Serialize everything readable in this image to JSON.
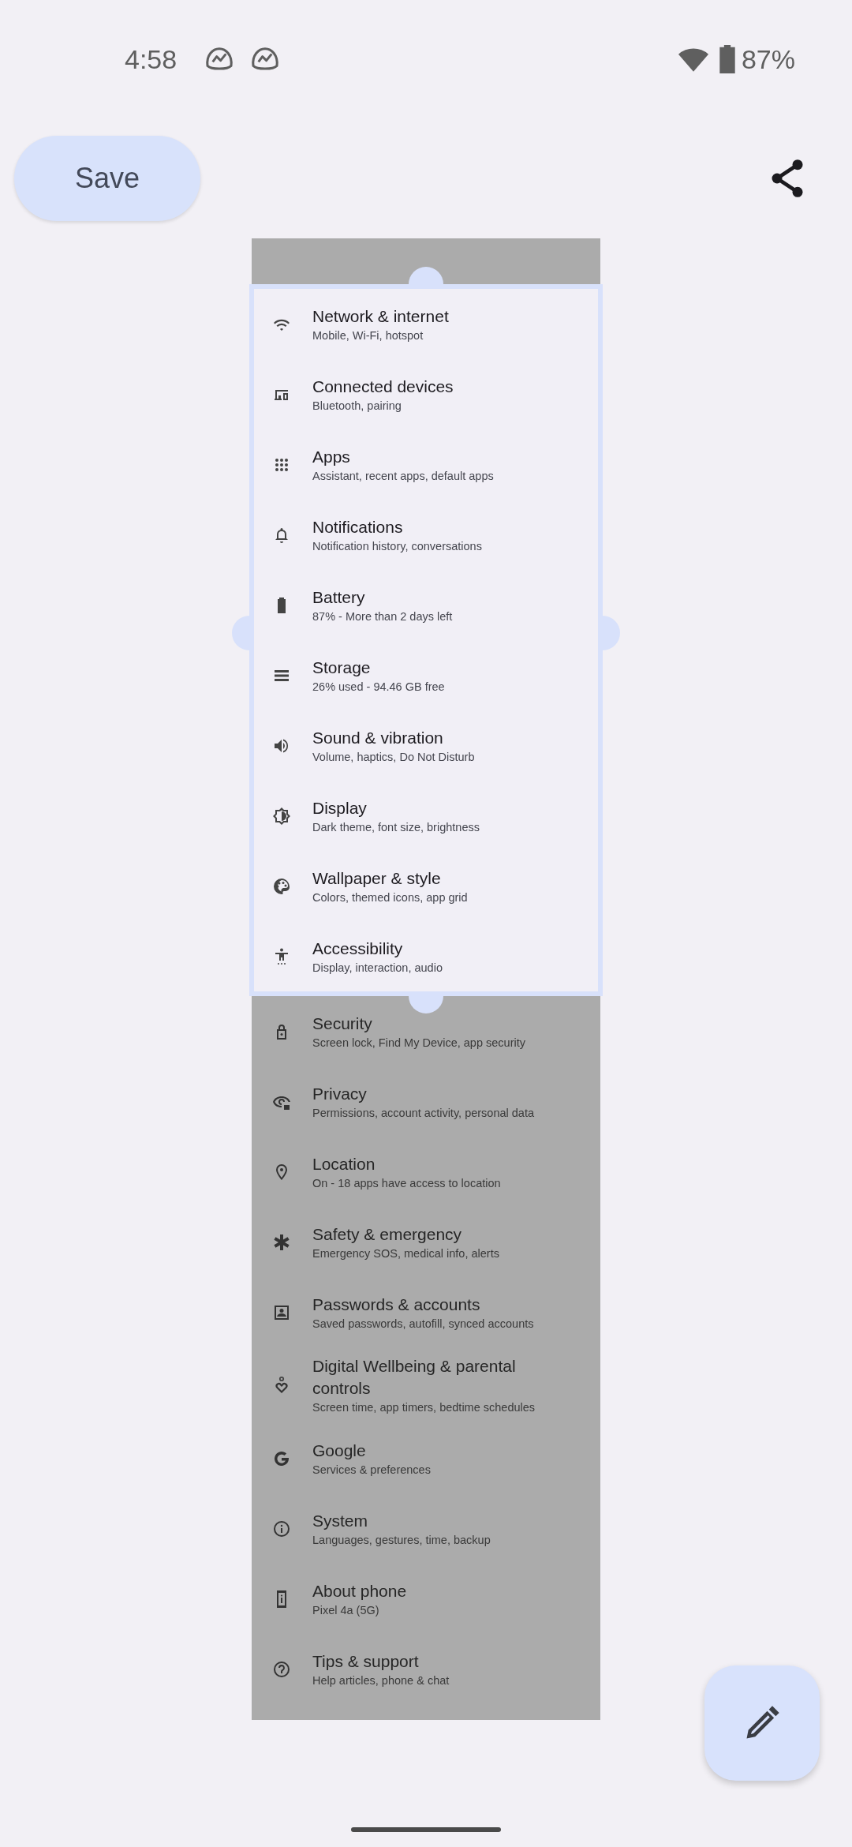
{
  "status_bar": {
    "time": "4:58",
    "battery": "87%"
  },
  "toolbar": {
    "save_button": "Save"
  },
  "screenshot": {
    "inside_crop": [
      {
        "title": "Network & internet",
        "subtitle": "Mobile, Wi-Fi, hotspot"
      },
      {
        "title": "Connected devices",
        "subtitle": "Bluetooth, pairing"
      },
      {
        "title": "Apps",
        "subtitle": "Assistant, recent apps, default apps"
      },
      {
        "title": "Notifications",
        "subtitle": "Notification history, conversations"
      },
      {
        "title": "Battery",
        "subtitle": "87% - More than 2 days left"
      },
      {
        "title": "Storage",
        "subtitle": "26% used - 94.46 GB free"
      },
      {
        "title": "Sound & vibration",
        "subtitle": "Volume, haptics, Do Not Disturb"
      },
      {
        "title": "Display",
        "subtitle": "Dark theme, font size, brightness"
      },
      {
        "title": "Wallpaper & style",
        "subtitle": "Colors, themed icons, app grid"
      },
      {
        "title": "Accessibility",
        "subtitle": "Display, interaction, audio"
      }
    ],
    "below_crop": [
      {
        "title": "Security",
        "subtitle": "Screen lock, Find My Device, app security"
      },
      {
        "title": "Privacy",
        "subtitle": "Permissions, account activity, personal data"
      },
      {
        "title": "Location",
        "subtitle": "On - 18 apps have access to location"
      },
      {
        "title": "Safety & emergency",
        "subtitle": "Emergency SOS, medical info, alerts"
      },
      {
        "title": "Passwords & accounts",
        "subtitle": "Saved passwords, autofill, synced accounts"
      },
      {
        "title": "Digital Wellbeing & parental controls",
        "subtitle": "Screen time, app timers, bedtime schedules"
      },
      {
        "title": "Google",
        "subtitle": "Services & preferences"
      },
      {
        "title": "System",
        "subtitle": "Languages, gestures, time, backup"
      },
      {
        "title": "About phone",
        "subtitle": "Pixel 4a (5G)"
      },
      {
        "title": "Tips & support",
        "subtitle": "Help articles, phone & chat"
      }
    ]
  }
}
